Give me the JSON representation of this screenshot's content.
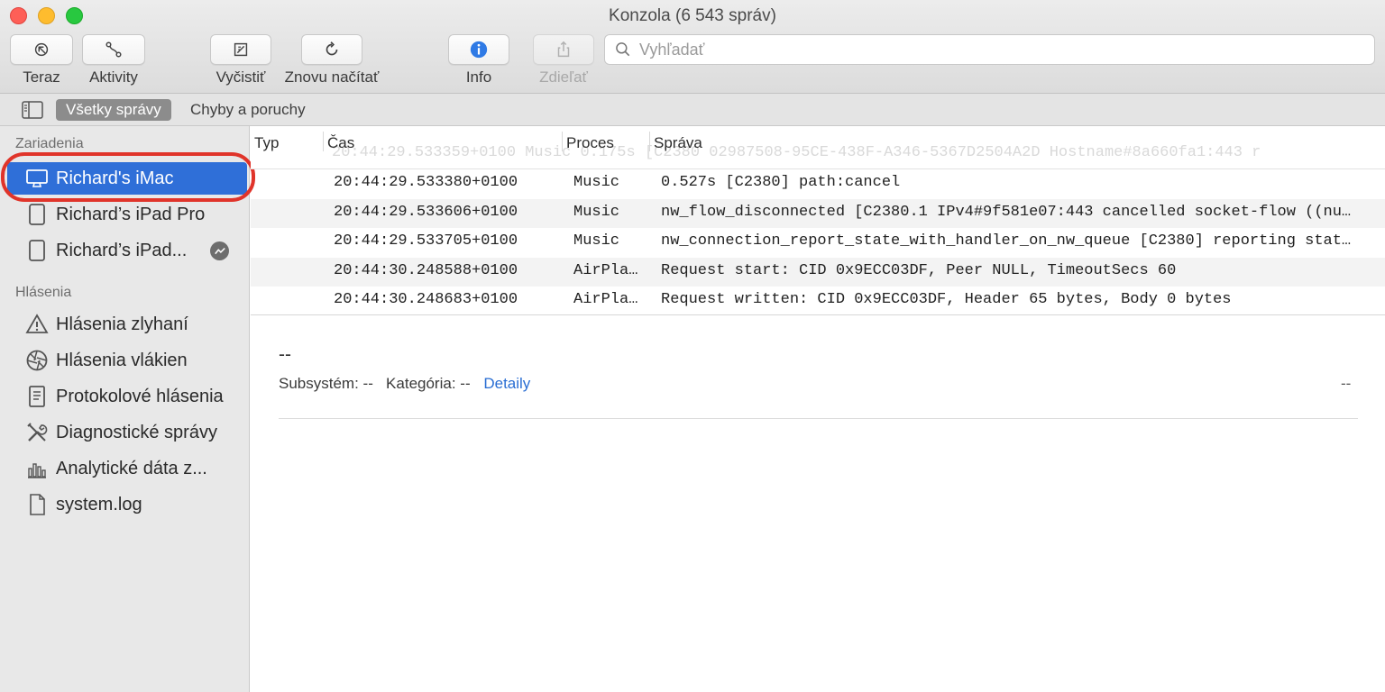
{
  "window": {
    "title": "Konzola (6 543 správ)"
  },
  "toolbar": {
    "now": "Teraz",
    "activities": "Aktivity",
    "clear": "Vyčistiť",
    "reload": "Znovu načítať",
    "info": "Info",
    "share": "Zdieľať"
  },
  "search": {
    "placeholder": "Vyhľadať"
  },
  "filterbar": {
    "all_messages": "Všetky správy",
    "errors_faults": "Chyby a poruchy"
  },
  "sidebar": {
    "devices_header": "Zariadenia",
    "devices": [
      {
        "label": "Richard's iMac",
        "icon": "imac-icon",
        "selected": true
      },
      {
        "label": "Richard’s iPad Pro",
        "icon": "ipad-icon"
      },
      {
        "label": "Richard’s iPad...",
        "icon": "ipad-icon",
        "badge": "activity-icon"
      }
    ],
    "reports_header": "Hlásenia",
    "reports": [
      {
        "label": "Hlásenia zlyhaní",
        "icon": "warning-icon"
      },
      {
        "label": "Hlásenia vlákien",
        "icon": "aperture-icon"
      },
      {
        "label": "Protokolové hlásenia",
        "icon": "document-list-icon"
      },
      {
        "label": "Diagnostické správy",
        "icon": "tools-icon"
      },
      {
        "label": "Analytické dáta z...",
        "icon": "bar-chart-icon"
      },
      {
        "label": "system.log",
        "icon": "file-icon"
      }
    ]
  },
  "table": {
    "columns": {
      "type": "Typ",
      "time": "Čas",
      "process": "Proces",
      "message": "Správa"
    },
    "ghost_row": "20:44:29.533359+0100    Music    0.175s [C2380 02987508-95CE-438F-A346-5367D2504A2D Hostname#8a660fa1:443 r",
    "rows": [
      {
        "time": "20:44:29.533380+0100",
        "process": "Music",
        "message": "0.527s [C2380] path:cancel"
      },
      {
        "time": "20:44:29.533606+0100",
        "process": "Music",
        "message": "nw_flow_disconnected [C2380.1 IPv4#9f581e07:443 cancelled socket-flow ((nu…"
      },
      {
        "time": "20:44:29.533705+0100",
        "process": "Music",
        "message": "nw_connection_report_state_with_handler_on_nw_queue [C2380] reporting stat…"
      },
      {
        "time": "20:44:30.248588+0100",
        "process": "AirPla…",
        "message": "Request start: CID 0x9ECC03DF, Peer NULL, TimeoutSecs 60"
      },
      {
        "time": "20:44:30.248683+0100",
        "process": "AirPla…",
        "message": "Request written: CID 0x9ECC03DF, Header 65 bytes, Body 0 bytes"
      }
    ]
  },
  "detail": {
    "title": "--",
    "subsystem_label": "Subsystém:",
    "subsystem_value": "--",
    "category_label": "Kategória:",
    "category_value": "--",
    "details_link": "Detaily",
    "right_value": "--"
  },
  "colors": {
    "selection": "#2f6fd8",
    "highlight_ring": "#e0342a",
    "link": "#2a6ed3",
    "info_icon": "#2f7ae5"
  }
}
